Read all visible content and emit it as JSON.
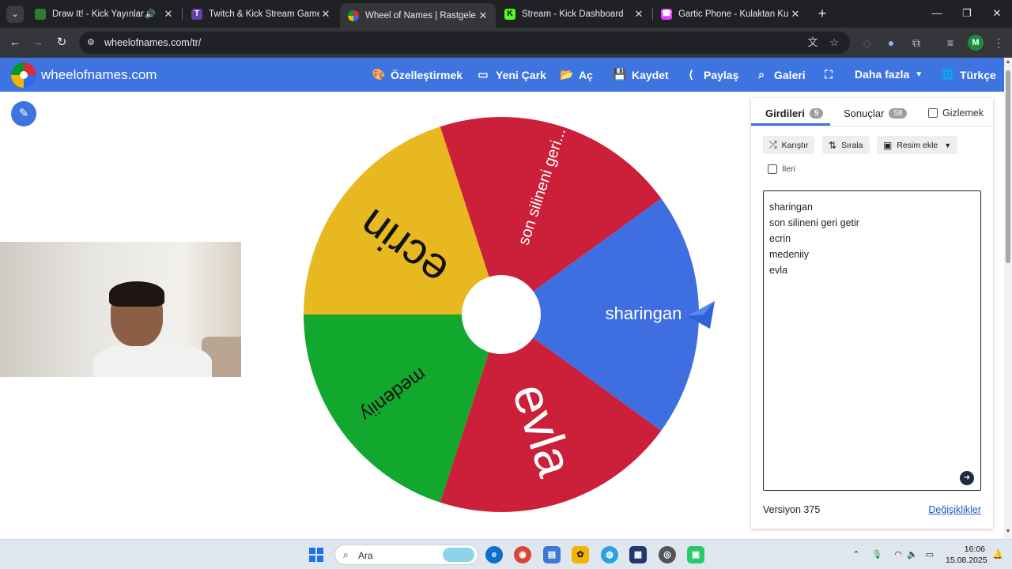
{
  "browser": {
    "tabs": [
      {
        "title": "Draw It! - Kick Yayınları İçin",
        "favicon_color": "#2e7d32",
        "audio": true
      },
      {
        "title": "Twitch & Kick Stream Games",
        "favicon_color": "#6441a5"
      },
      {
        "title": "Wheel of Names | Rastgele ad seçici",
        "favicon_color": "#dc2b36",
        "active": true
      },
      {
        "title": "Stream - Kick Dashboard",
        "favicon_color": "#53fc18"
      },
      {
        "title": "Gartic Phone - Kulaktan Kulağa",
        "favicon_color": "#e040fb"
      }
    ],
    "url": "wheelofnames.com/tr/",
    "profile_initial": "M"
  },
  "site": {
    "title": "wheelofnames.com",
    "menu": [
      {
        "label": "Özelleştirmek",
        "icon": "palette-icon"
      },
      {
        "label": "Yeni Çark",
        "icon": "file-icon"
      },
      {
        "label": "Aç",
        "icon": "folder-open-icon"
      },
      {
        "label": "Kaydet",
        "icon": "save-icon"
      },
      {
        "label": "Paylaş",
        "icon": "share-icon"
      },
      {
        "label": "Galeri",
        "icon": "search-icon"
      },
      {
        "label": "",
        "icon": "fullscreen-icon"
      },
      {
        "label": "Daha fazla",
        "icon": "chevron-down-icon"
      },
      {
        "label": "Türkçe",
        "icon": "globe-icon"
      }
    ]
  },
  "wheel": {
    "segments": [
      {
        "label": "sharingan",
        "color": "#3e6ee0",
        "text_color": "#ffffff"
      },
      {
        "label": "son silineni geri...",
        "color": "#cc1f3a",
        "text_color": "#ffffff"
      },
      {
        "label": "ecrin",
        "color": "#e8b820",
        "text_color": "#111111"
      },
      {
        "label": "medeniiy",
        "color": "#12a82e",
        "text_color": "#111111"
      },
      {
        "label": "evla",
        "color": "#cc1f3a",
        "text_color": "#ffffff"
      }
    ]
  },
  "panel": {
    "tab_entries": "Girdileri",
    "tab_entries_count": "5",
    "tab_results": "Sonuçlar",
    "tab_results_count": "58",
    "hide_label": "Gizlemek",
    "shuffle_label": "Karıştır",
    "sort_label": "Sırala",
    "add_image_label": "Resim ekle",
    "advanced_label": "İleri",
    "entries": [
      "sharingan",
      "son silineni geri getir",
      "ecrin",
      "medeniiy",
      "evla"
    ],
    "version": "Versiyon 375",
    "changes": "Değişiklikler"
  },
  "taskbar": {
    "search_placeholder": "Ara",
    "time": "16:06",
    "date": "15.08.2025"
  }
}
